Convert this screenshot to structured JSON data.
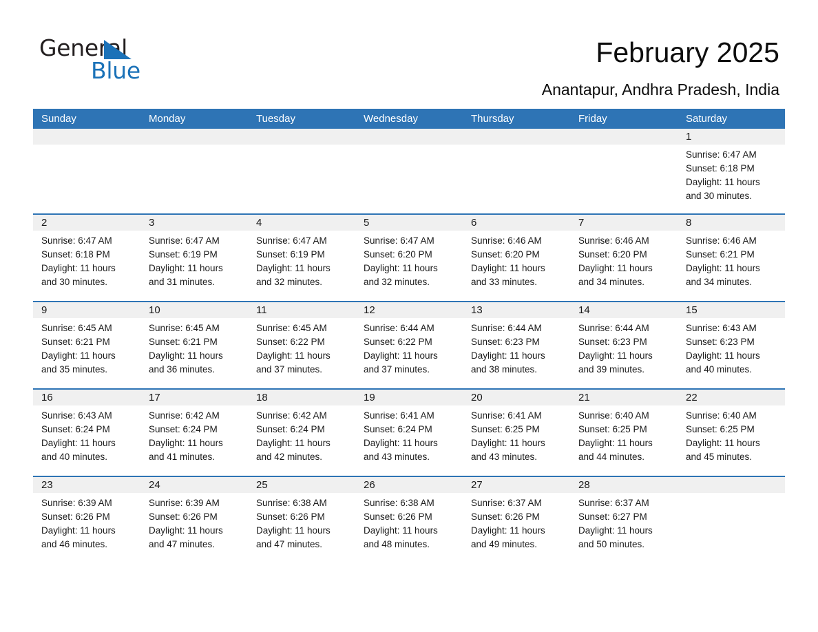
{
  "brand": {
    "name_top": "General",
    "name_bottom": "Blue",
    "triangle_color": "#1b72b8",
    "text_color": "#231f20"
  },
  "header": {
    "title": "February 2025",
    "subtitle": "Anantapur, Andhra Pradesh, India"
  },
  "theme": {
    "header_blue": "#2e74b5",
    "daynum_band": "#f0f0f0",
    "page_background": "#ffffff",
    "text": "#1a1a1a"
  },
  "calendar": {
    "weekdays": [
      "Sunday",
      "Monday",
      "Tuesday",
      "Wednesday",
      "Thursday",
      "Friday",
      "Saturday"
    ],
    "weeks": [
      [
        {
          "day": "",
          "sunrise": "",
          "sunset": "",
          "daylight": "",
          "empty": true
        },
        {
          "day": "",
          "sunrise": "",
          "sunset": "",
          "daylight": "",
          "empty": true
        },
        {
          "day": "",
          "sunrise": "",
          "sunset": "",
          "daylight": "",
          "empty": true
        },
        {
          "day": "",
          "sunrise": "",
          "sunset": "",
          "daylight": "",
          "empty": true
        },
        {
          "day": "",
          "sunrise": "",
          "sunset": "",
          "daylight": "",
          "empty": true
        },
        {
          "day": "",
          "sunrise": "",
          "sunset": "",
          "daylight": "",
          "empty": true
        },
        {
          "day": "1",
          "sunrise": "Sunrise: 6:47 AM",
          "sunset": "Sunset: 6:18 PM",
          "daylight": "Daylight: 11 hours and 30 minutes.",
          "empty": false
        }
      ],
      [
        {
          "day": "2",
          "sunrise": "Sunrise: 6:47 AM",
          "sunset": "Sunset: 6:18 PM",
          "daylight": "Daylight: 11 hours and 30 minutes.",
          "empty": false
        },
        {
          "day": "3",
          "sunrise": "Sunrise: 6:47 AM",
          "sunset": "Sunset: 6:19 PM",
          "daylight": "Daylight: 11 hours and 31 minutes.",
          "empty": false
        },
        {
          "day": "4",
          "sunrise": "Sunrise: 6:47 AM",
          "sunset": "Sunset: 6:19 PM",
          "daylight": "Daylight: 11 hours and 32 minutes.",
          "empty": false
        },
        {
          "day": "5",
          "sunrise": "Sunrise: 6:47 AM",
          "sunset": "Sunset: 6:20 PM",
          "daylight": "Daylight: 11 hours and 32 minutes.",
          "empty": false
        },
        {
          "day": "6",
          "sunrise": "Sunrise: 6:46 AM",
          "sunset": "Sunset: 6:20 PM",
          "daylight": "Daylight: 11 hours and 33 minutes.",
          "empty": false
        },
        {
          "day": "7",
          "sunrise": "Sunrise: 6:46 AM",
          "sunset": "Sunset: 6:20 PM",
          "daylight": "Daylight: 11 hours and 34 minutes.",
          "empty": false
        },
        {
          "day": "8",
          "sunrise": "Sunrise: 6:46 AM",
          "sunset": "Sunset: 6:21 PM",
          "daylight": "Daylight: 11 hours and 34 minutes.",
          "empty": false
        }
      ],
      [
        {
          "day": "9",
          "sunrise": "Sunrise: 6:45 AM",
          "sunset": "Sunset: 6:21 PM",
          "daylight": "Daylight: 11 hours and 35 minutes.",
          "empty": false
        },
        {
          "day": "10",
          "sunrise": "Sunrise: 6:45 AM",
          "sunset": "Sunset: 6:21 PM",
          "daylight": "Daylight: 11 hours and 36 minutes.",
          "empty": false
        },
        {
          "day": "11",
          "sunrise": "Sunrise: 6:45 AM",
          "sunset": "Sunset: 6:22 PM",
          "daylight": "Daylight: 11 hours and 37 minutes.",
          "empty": false
        },
        {
          "day": "12",
          "sunrise": "Sunrise: 6:44 AM",
          "sunset": "Sunset: 6:22 PM",
          "daylight": "Daylight: 11 hours and 37 minutes.",
          "empty": false
        },
        {
          "day": "13",
          "sunrise": "Sunrise: 6:44 AM",
          "sunset": "Sunset: 6:23 PM",
          "daylight": "Daylight: 11 hours and 38 minutes.",
          "empty": false
        },
        {
          "day": "14",
          "sunrise": "Sunrise: 6:44 AM",
          "sunset": "Sunset: 6:23 PM",
          "daylight": "Daylight: 11 hours and 39 minutes.",
          "empty": false
        },
        {
          "day": "15",
          "sunrise": "Sunrise: 6:43 AM",
          "sunset": "Sunset: 6:23 PM",
          "daylight": "Daylight: 11 hours and 40 minutes.",
          "empty": false
        }
      ],
      [
        {
          "day": "16",
          "sunrise": "Sunrise: 6:43 AM",
          "sunset": "Sunset: 6:24 PM",
          "daylight": "Daylight: 11 hours and 40 minutes.",
          "empty": false
        },
        {
          "day": "17",
          "sunrise": "Sunrise: 6:42 AM",
          "sunset": "Sunset: 6:24 PM",
          "daylight": "Daylight: 11 hours and 41 minutes.",
          "empty": false
        },
        {
          "day": "18",
          "sunrise": "Sunrise: 6:42 AM",
          "sunset": "Sunset: 6:24 PM",
          "daylight": "Daylight: 11 hours and 42 minutes.",
          "empty": false
        },
        {
          "day": "19",
          "sunrise": "Sunrise: 6:41 AM",
          "sunset": "Sunset: 6:24 PM",
          "daylight": "Daylight: 11 hours and 43 minutes.",
          "empty": false
        },
        {
          "day": "20",
          "sunrise": "Sunrise: 6:41 AM",
          "sunset": "Sunset: 6:25 PM",
          "daylight": "Daylight: 11 hours and 43 minutes.",
          "empty": false
        },
        {
          "day": "21",
          "sunrise": "Sunrise: 6:40 AM",
          "sunset": "Sunset: 6:25 PM",
          "daylight": "Daylight: 11 hours and 44 minutes.",
          "empty": false
        },
        {
          "day": "22",
          "sunrise": "Sunrise: 6:40 AM",
          "sunset": "Sunset: 6:25 PM",
          "daylight": "Daylight: 11 hours and 45 minutes.",
          "empty": false
        }
      ],
      [
        {
          "day": "23",
          "sunrise": "Sunrise: 6:39 AM",
          "sunset": "Sunset: 6:26 PM",
          "daylight": "Daylight: 11 hours and 46 minutes.",
          "empty": false
        },
        {
          "day": "24",
          "sunrise": "Sunrise: 6:39 AM",
          "sunset": "Sunset: 6:26 PM",
          "daylight": "Daylight: 11 hours and 47 minutes.",
          "empty": false
        },
        {
          "day": "25",
          "sunrise": "Sunrise: 6:38 AM",
          "sunset": "Sunset: 6:26 PM",
          "daylight": "Daylight: 11 hours and 47 minutes.",
          "empty": false
        },
        {
          "day": "26",
          "sunrise": "Sunrise: 6:38 AM",
          "sunset": "Sunset: 6:26 PM",
          "daylight": "Daylight: 11 hours and 48 minutes.",
          "empty": false
        },
        {
          "day": "27",
          "sunrise": "Sunrise: 6:37 AM",
          "sunset": "Sunset: 6:26 PM",
          "daylight": "Daylight: 11 hours and 49 minutes.",
          "empty": false
        },
        {
          "day": "28",
          "sunrise": "Sunrise: 6:37 AM",
          "sunset": "Sunset: 6:27 PM",
          "daylight": "Daylight: 11 hours and 50 minutes.",
          "empty": false
        },
        {
          "day": "",
          "sunrise": "",
          "sunset": "",
          "daylight": "",
          "empty": true
        }
      ]
    ]
  }
}
